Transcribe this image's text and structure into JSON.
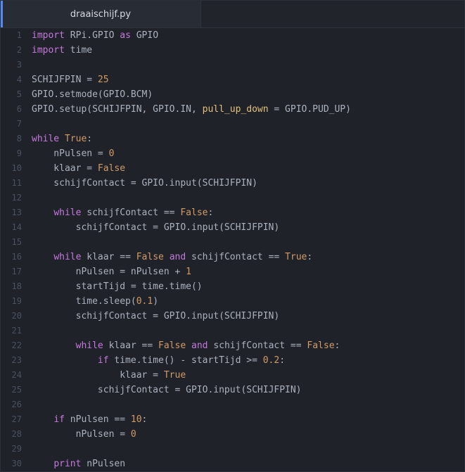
{
  "tab": {
    "title": "draaischijf.py"
  },
  "colors": {
    "keyword": "#c678dd",
    "constant": "#d19a66",
    "number": "#d19a66",
    "param": "#e5c07b",
    "text": "#abb2bf",
    "line_number": "#495162",
    "tab_accent": "#568af2"
  },
  "lines": [
    {
      "n": "1",
      "tokens": [
        [
          "kw",
          "import"
        ],
        [
          "text",
          " RPi.GPIO "
        ],
        [
          "kw",
          "as"
        ],
        [
          "text",
          " GPIO"
        ]
      ]
    },
    {
      "n": "2",
      "tokens": [
        [
          "kw",
          "import"
        ],
        [
          "text",
          " time"
        ]
      ]
    },
    {
      "n": "3",
      "tokens": []
    },
    {
      "n": "4",
      "tokens": [
        [
          "text",
          "SCHIJFPIN = "
        ],
        [
          "num",
          "25"
        ]
      ]
    },
    {
      "n": "5",
      "tokens": [
        [
          "text",
          "GPIO.setmode(GPIO.BCM)"
        ]
      ]
    },
    {
      "n": "6",
      "tokens": [
        [
          "text",
          "GPIO.setup(SCHIJFPIN, GPIO.IN, "
        ],
        [
          "param",
          "pull_up_down"
        ],
        [
          "text",
          " = GPIO.PUD_UP)"
        ]
      ]
    },
    {
      "n": "7",
      "tokens": []
    },
    {
      "n": "8",
      "tokens": [
        [
          "kw",
          "while"
        ],
        [
          "text",
          " "
        ],
        [
          "const",
          "True"
        ],
        [
          "text",
          ":"
        ]
      ]
    },
    {
      "n": "9",
      "tokens": [
        [
          "text",
          "    nPulsen = "
        ],
        [
          "num",
          "0"
        ]
      ]
    },
    {
      "n": "10",
      "tokens": [
        [
          "text",
          "    klaar = "
        ],
        [
          "const",
          "False"
        ]
      ]
    },
    {
      "n": "11",
      "tokens": [
        [
          "text",
          "    schijfContact = GPIO.input(SCHIJFPIN)"
        ]
      ]
    },
    {
      "n": "12",
      "tokens": []
    },
    {
      "n": "13",
      "tokens": [
        [
          "text",
          "    "
        ],
        [
          "kw",
          "while"
        ],
        [
          "text",
          " schijfContact == "
        ],
        [
          "const",
          "False"
        ],
        [
          "text",
          ":"
        ]
      ]
    },
    {
      "n": "14",
      "tokens": [
        [
          "text",
          "        schijfContact = GPIO.input(SCHIJFPIN)"
        ]
      ]
    },
    {
      "n": "15",
      "tokens": []
    },
    {
      "n": "16",
      "tokens": [
        [
          "text",
          "    "
        ],
        [
          "kw",
          "while"
        ],
        [
          "text",
          " klaar == "
        ],
        [
          "const",
          "False"
        ],
        [
          "text",
          " "
        ],
        [
          "kw",
          "and"
        ],
        [
          "text",
          " schijfContact == "
        ],
        [
          "const",
          "True"
        ],
        [
          "text",
          ":"
        ]
      ]
    },
    {
      "n": "17",
      "tokens": [
        [
          "text",
          "        nPulsen = nPulsen + "
        ],
        [
          "num",
          "1"
        ]
      ]
    },
    {
      "n": "18",
      "tokens": [
        [
          "text",
          "        startTijd = time.time()"
        ]
      ]
    },
    {
      "n": "19",
      "tokens": [
        [
          "text",
          "        time.sleep("
        ],
        [
          "num",
          "0.1"
        ],
        [
          "text",
          ")"
        ]
      ]
    },
    {
      "n": "20",
      "tokens": [
        [
          "text",
          "        schijfContact = GPIO.input(SCHIJFPIN)"
        ]
      ]
    },
    {
      "n": "21",
      "tokens": []
    },
    {
      "n": "22",
      "tokens": [
        [
          "text",
          "        "
        ],
        [
          "kw",
          "while"
        ],
        [
          "text",
          " klaar == "
        ],
        [
          "const",
          "False"
        ],
        [
          "text",
          " "
        ],
        [
          "kw",
          "and"
        ],
        [
          "text",
          " schijfContact == "
        ],
        [
          "const",
          "False"
        ],
        [
          "text",
          ":"
        ]
      ]
    },
    {
      "n": "23",
      "tokens": [
        [
          "text",
          "            "
        ],
        [
          "kw",
          "if"
        ],
        [
          "text",
          " time.time() - startTijd >= "
        ],
        [
          "num",
          "0.2"
        ],
        [
          "text",
          ":"
        ]
      ]
    },
    {
      "n": "24",
      "tokens": [
        [
          "text",
          "                klaar = "
        ],
        [
          "const",
          "True"
        ]
      ]
    },
    {
      "n": "25",
      "tokens": [
        [
          "text",
          "            schijfContact = GPIO.input(SCHIJFPIN)"
        ]
      ]
    },
    {
      "n": "26",
      "tokens": []
    },
    {
      "n": "27",
      "tokens": [
        [
          "text",
          "    "
        ],
        [
          "kw",
          "if"
        ],
        [
          "text",
          " nPulsen == "
        ],
        [
          "num",
          "10"
        ],
        [
          "text",
          ":"
        ]
      ]
    },
    {
      "n": "28",
      "tokens": [
        [
          "text",
          "        nPulsen = "
        ],
        [
          "num",
          "0"
        ]
      ]
    },
    {
      "n": "29",
      "tokens": []
    },
    {
      "n": "30",
      "tokens": [
        [
          "text",
          "    "
        ],
        [
          "kw",
          "print"
        ],
        [
          "text",
          " nPulsen"
        ]
      ]
    }
  ]
}
